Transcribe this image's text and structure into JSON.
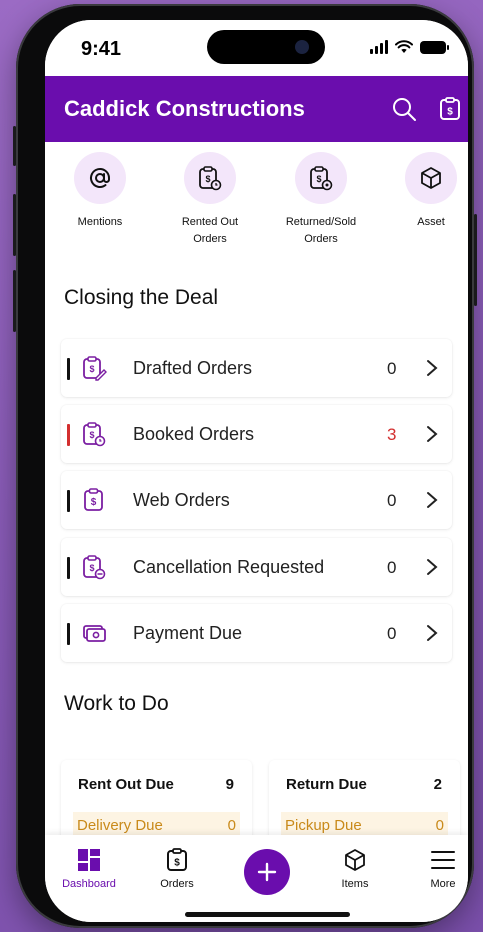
{
  "status": {
    "time": "9:41"
  },
  "header": {
    "title": "Caddick Constructions"
  },
  "quick_actions": [
    {
      "label": "Mentions",
      "icon": "at-icon"
    },
    {
      "label": "Rented Out\nOrders",
      "icon": "clipboard-dollar-clock-icon"
    },
    {
      "label": "Returned/Sold\nOrders",
      "icon": "clipboard-dollar-return-icon"
    },
    {
      "label": "Asset",
      "icon": "cube-icon"
    }
  ],
  "closing": {
    "title": "Closing the Deal",
    "rows": [
      {
        "label": "Drafted Orders",
        "count": "0",
        "icon": "clipboard-edit-icon"
      },
      {
        "label": "Booked Orders",
        "count": "3",
        "icon": "clipboard-clock-icon"
      },
      {
        "label": "Web Orders",
        "count": "0",
        "icon": "clipboard-dollar-icon"
      },
      {
        "label": "Cancellation Requested",
        "count": "0",
        "icon": "clipboard-cancel-icon"
      },
      {
        "label": "Payment Due",
        "count": "0",
        "icon": "cash-icon"
      }
    ]
  },
  "work": {
    "title": "Work to Do",
    "cards": [
      {
        "title": "Rent Out Due",
        "count": "9",
        "sub_label": "Delivery Due",
        "sub_count": "0"
      },
      {
        "title": "Return Due",
        "count": "2",
        "sub_label": "Pickup Due",
        "sub_count": "0"
      }
    ]
  },
  "tabs": [
    {
      "label": "Dashboard",
      "icon": "dashboard-icon"
    },
    {
      "label": "Orders",
      "icon": "clipboard-icon"
    },
    {
      "label": "Items",
      "icon": "cube-icon"
    },
    {
      "label": "More",
      "icon": "menu-icon"
    }
  ],
  "colors": {
    "primary": "#6a0dad",
    "alert": "#d32f2f",
    "pending": "#c98a1a"
  }
}
